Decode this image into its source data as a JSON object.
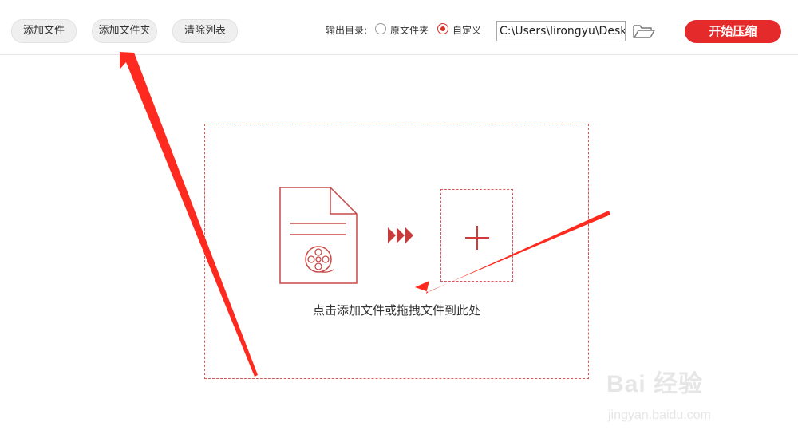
{
  "toolbar": {
    "add_file": "添加文件",
    "add_folder": "添加文件夹",
    "clear_list": "清除列表",
    "output_dir_label": "输出目录:",
    "option_original": "原文件夹",
    "option_custom": "自定义",
    "selected_option": "自定义",
    "path_value": "C:\\Users\\lirongyu\\Desk",
    "folder_icon": "folder-open-icon",
    "start_button": "开始压缩"
  },
  "drop_zone": {
    "hint": "点击添加文件或拖拽文件到此处",
    "file_icon": "video-file-icon",
    "arrow_icon": "triple-chevron-right-icon",
    "plus_icon": "plus-icon"
  },
  "watermark": {
    "brand": "Bai 经验",
    "url": "jingyan.baidu.com"
  },
  "colors": {
    "accent": "#e42a2a",
    "dashed_border": "#d9595a",
    "annotation_arrow": "#ff2a1f"
  }
}
